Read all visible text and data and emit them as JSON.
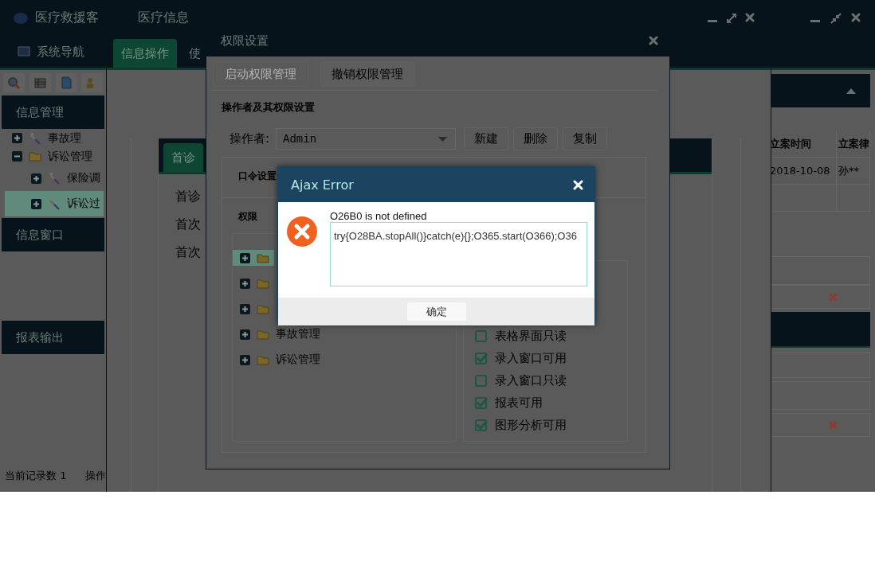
{
  "background_window": {
    "title": "医疗救援客",
    "nav_tab": "系统导航",
    "sidebar": [
      {
        "title": "信息管理",
        "tree": [
          {
            "label": "事故理",
            "kind": "leaf",
            "expanded": false,
            "selected": false
          },
          {
            "label": "诉讼管理",
            "kind": "folder",
            "expanded": true,
            "selected": false,
            "children": [
              {
                "label": "保险调",
                "kind": "leaf",
                "expanded": false,
                "selected": false
              },
              {
                "label": "诉讼过",
                "kind": "leaf",
                "expanded": false,
                "selected": true
              }
            ]
          }
        ]
      },
      {
        "title": "信息窗口"
      },
      {
        "title": "报表输出"
      }
    ],
    "table": {
      "columns": [
        "立案时间",
        "立案律"
      ],
      "rows": [
        [
          "2018-10-08",
          "孙**"
        ]
      ]
    },
    "status_bar": [
      "当前记录数 1",
      "操作"
    ]
  },
  "info_window": {
    "title": "医疗信息",
    "tabs": [
      {
        "label": "信息操作",
        "selected": true
      },
      {
        "label": "使",
        "selected": false
      }
    ],
    "panel_tab": "首诊",
    "lines": [
      "首诊",
      "首次",
      "首次"
    ]
  },
  "permission_dialog": {
    "title": "权限设置",
    "top_buttons": [
      {
        "label": "启动权限管理",
        "disabled": true
      },
      {
        "label": "撤销权限管理",
        "disabled": false
      }
    ],
    "section_title": "操作者及其权限设置",
    "operator_label": "操作者:",
    "operator_value": "Admin",
    "actions": [
      "新建",
      "删除",
      "复制"
    ],
    "password_label": "口令设置",
    "permissions_label": "权限",
    "tree": [
      {
        "expanded": false,
        "selected": true
      },
      {
        "expanded": false,
        "selected": false
      },
      {
        "expanded": false,
        "selected": false
      },
      {
        "label": "事故管理",
        "expanded": false,
        "selected": false
      },
      {
        "label": "诉讼管理",
        "expanded": false,
        "selected": false
      }
    ],
    "checkboxes": [
      {
        "label": "表格界面只读",
        "checked": false
      },
      {
        "label": "录入窗口可用",
        "checked": true
      },
      {
        "label": "录入窗口只读",
        "checked": false
      },
      {
        "label": "报表可用",
        "checked": true
      },
      {
        "label": "图形分析可用",
        "checked": true
      }
    ]
  },
  "error_dialog": {
    "title": "Ajax Error",
    "message": "O26B0 is not defined",
    "detail": "try{O28BA.stopAll()}catch(e){};O365.start(O366);O36",
    "ok_button": "确定"
  }
}
